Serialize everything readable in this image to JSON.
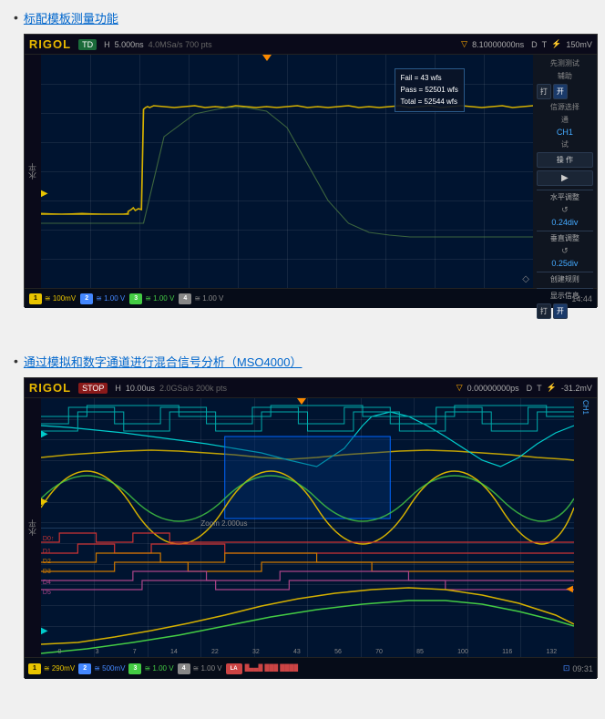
{
  "sections": [
    {
      "id": "section1",
      "bullet": "•",
      "link_text": "标配模板测量功能",
      "osc": {
        "logo": "RIGOL",
        "mode_badge": "TD",
        "header_items": [
          "H",
          "5.000ns",
          "4.0MSa/s",
          "700 pts"
        ],
        "time_display": "8.10000000ns",
        "trigger_info": "T",
        "volt_display": "150mV",
        "left_label": "水平",
        "tooltip": {
          "fail": "Fail = 43 wfs",
          "pass": "Pass = 52501 wfs",
          "total": "Total = 52544 wfs"
        },
        "right_panel": {
          "items": [
            {
              "type": "label",
              "text": "先测测试"
            },
            {
              "type": "row",
              "label": "辅助",
              "value": ""
            },
            {
              "type": "btn2",
              "label1": "打",
              "label2": "开"
            },
            {
              "type": "label",
              "text": "信源选择"
            },
            {
              "type": "label",
              "text": "通"
            },
            {
              "type": "ch_label",
              "text": "CH1"
            },
            {
              "type": "label",
              "text": "试"
            },
            {
              "type": "btn",
              "text": "操 作"
            },
            {
              "type": "btn",
              "text": "▶"
            },
            {
              "type": "section",
              "text": "水平调整"
            },
            {
              "type": "label",
              "text": "↺"
            },
            {
              "type": "value",
              "text": "0.24div"
            },
            {
              "type": "section",
              "text": "垂直调整"
            },
            {
              "type": "label",
              "text": "↺"
            },
            {
              "type": "value",
              "text": "0.25div"
            },
            {
              "type": "section",
              "text": "创建规则"
            },
            {
              "type": "section",
              "text": "显示信息"
            },
            {
              "type": "btn2",
              "label1": "打",
              "label2": "开"
            }
          ]
        },
        "footer": {
          "channels": [
            {
              "num": "1",
              "color": "#e8c400",
              "text": "≅ 100mV"
            },
            {
              "num": "2",
              "color": "#4488ff",
              "text": "≅ 1.00 V"
            },
            {
              "num": "3",
              "color": "#44cc44",
              "text": "≅ 1.00 V"
            },
            {
              "num": "4",
              "color": "#888888",
              "text": "≅ 1.00 V"
            }
          ],
          "time": "14:44"
        }
      }
    },
    {
      "id": "section2",
      "bullet": "•",
      "link_text": "通过模拟和数字通道进行混合信号分析（MSO4000）",
      "osc": {
        "logo": "RIGOL",
        "mode_badge": "STOP",
        "header_items": [
          "H",
          "10.00us",
          "2.0GSa/s",
          "200k pts"
        ],
        "time_display": "0.00000000ps",
        "trigger_info": "T",
        "volt_display": "-31.2mV",
        "left_label": "水平",
        "zoom_label": "Zoom 2.000us",
        "right_label": "CH1",
        "footer": {
          "channels": [
            {
              "num": "1",
              "color": "#e8c400",
              "text": "≅ 290mV"
            },
            {
              "num": "2",
              "color": "#4488ff",
              "text": "≅ 500mV"
            },
            {
              "num": "3",
              "color": "#44cc44",
              "text": "≅ 1.00 V"
            },
            {
              "num": "4",
              "color": "#888888",
              "text": "≅ 1.00 V"
            },
            {
              "num": "LA",
              "color": "#cc4444",
              "text": "█▄█▄█ ██████"
            }
          ],
          "time": "09:31",
          "usb_icon": "⊕09:31"
        }
      }
    }
  ]
}
